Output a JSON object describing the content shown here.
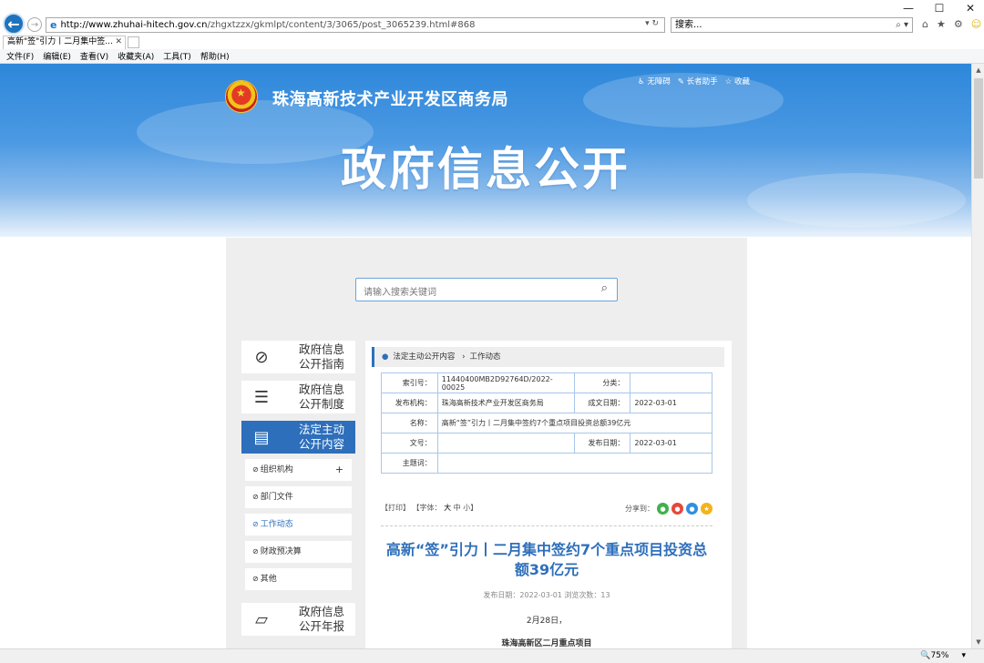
{
  "window": {
    "min": "—",
    "max": "☐",
    "close": "✕"
  },
  "address": {
    "back": "←",
    "forward": "→",
    "url_host": "http://www.zhuhai-hitech.gov.cn",
    "url_path": "/zhgxtzzx/gkmlpt/content/3/3065/post_3065239.html#868",
    "url_tools": "▾ ↻",
    "search_placeholder": "搜索...",
    "search_tools": "⌕ ▾"
  },
  "tab": {
    "label": "高新\"签\"引力丨二月集中签...",
    "close": "✕"
  },
  "menu": [
    "文件(F)",
    "编辑(E)",
    "查看(V)",
    "收藏夹(A)",
    "工具(T)",
    "帮助(H)"
  ],
  "header": {
    "site_name": "珠海高新技术产业开发区商务局",
    "links": [
      "♿ 无障碍",
      "✎ 长者助手",
      "☆ 收藏"
    ],
    "hero_title": "政府信息公开"
  },
  "search": {
    "placeholder": "请输入搜索关键词"
  },
  "left_nav": {
    "big": [
      {
        "line1": "政府信息",
        "line2": "公开指南",
        "icon": "compass-icon"
      },
      {
        "line1": "政府信息",
        "line2": "公开制度",
        "icon": "list-icon"
      },
      {
        "line1": "法定主动",
        "line2": "公开内容",
        "icon": "document-icon"
      },
      {
        "line1": "政府信息",
        "line2": "公开年报",
        "icon": "folder-icon"
      }
    ],
    "sub": [
      "组织机构",
      "部门文件",
      "工作动态",
      "财政预决算",
      "其他"
    ],
    "plus": "+"
  },
  "breadcrumb": {
    "item1": "法定主动公开内容",
    "sep": "›",
    "item2": "工作动态"
  },
  "meta_table": {
    "index_label": "索引号：",
    "index_value": "11440400MB2D92764D/2022-00025",
    "category_label": "分类：",
    "category_value": "",
    "publisher_label": "发布机构：",
    "publisher_value": "珠海高新技术产业开发区商务局",
    "created_label": "成文日期：",
    "created_value": "2022-03-01",
    "name_label": "名称：",
    "name_value": "高新“签”引力丨二月集中签约7个重点项目投资总额39亿元",
    "docno_label": "文号：",
    "docno_value": "",
    "pubdate_label": "发布日期：",
    "pubdate_value": "2022-03-01",
    "keywords_label": "主题词：",
    "keywords_value": ""
  },
  "tools": {
    "print": "【打印】",
    "font": "【字体：",
    "font_big": "大",
    "font_mid": "中",
    "font_small": "小",
    "font_close": "】",
    "share_label": "分享到："
  },
  "article": {
    "title": "高新“签”引力丨二月集中签约7个重点项目投资总额39亿元",
    "meta": "发布日期：2022-03-01    浏览次数：13",
    "para1": "2月28日，",
    "para2": "珠海高新区二月重点项目"
  },
  "status": {
    "zoom": "🔍75%",
    "zoom_drop": "▾"
  },
  "colors": {
    "accent": "#2e6fbb",
    "hero_top": "#2e87da"
  }
}
